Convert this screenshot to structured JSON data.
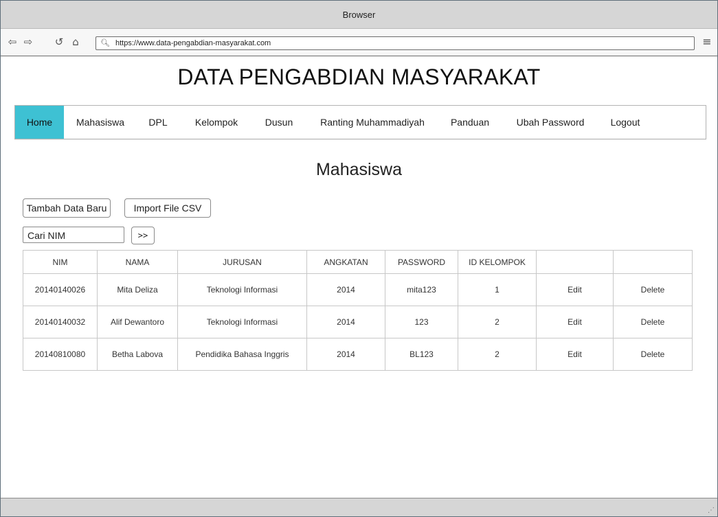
{
  "window": {
    "title": "Browser"
  },
  "toolbar": {
    "back_icon": "back-arrow-icon",
    "forward_icon": "forward-arrow-icon",
    "reload_icon": "reload-icon",
    "home_icon": "home-icon",
    "search_icon": "search-icon",
    "menu_icon": "hamburger-menu-icon",
    "url": "https://www.data-pengabdian-masyarakat.com"
  },
  "header": {
    "title": "DATA PENGABDIAN MASYARAKAT"
  },
  "nav": {
    "active_color": "#3ec1d3",
    "items": [
      {
        "label": "Home",
        "active": true
      },
      {
        "label": "Mahasiswa"
      },
      {
        "label": "DPL"
      },
      {
        "label": "Kelompok"
      },
      {
        "label": "Dusun"
      },
      {
        "label": "Ranting Muhammadiyah"
      },
      {
        "label": "Panduan"
      },
      {
        "label": "Ubah Password"
      },
      {
        "label": "Logout"
      }
    ]
  },
  "section": {
    "title": "Mahasiswa"
  },
  "actions": {
    "add_label": "Tambah Data Baru",
    "import_label": "Import File CSV",
    "search_value": "Cari NIM",
    "go_label": ">>"
  },
  "table": {
    "headers": [
      "NIM",
      "NAMA",
      "JURUSAN",
      "ANGKATAN",
      "PASSWORD",
      "ID KELOMPOK",
      "",
      ""
    ],
    "rows": [
      {
        "nim": "20140140026",
        "nama": "Mita Deliza",
        "jurusan": "Teknologi Informasi",
        "angkatan": "2014",
        "password": "mita123",
        "id_kelompok": "1",
        "edit": "Edit",
        "delete": "Delete"
      },
      {
        "nim": "20140140032",
        "nama": "Alif Dewantoro",
        "jurusan": "Teknologi Informasi",
        "angkatan": "2014",
        "password": "123",
        "id_kelompok": "2",
        "edit": "Edit",
        "delete": "Delete"
      },
      {
        "nim": "20140810080",
        "nama": "Betha Labova",
        "jurusan": "Pendidika Bahasa Inggris",
        "angkatan": "2014",
        "password": "BL123",
        "id_kelompok": "2",
        "edit": "Edit",
        "delete": "Delete"
      }
    ]
  }
}
